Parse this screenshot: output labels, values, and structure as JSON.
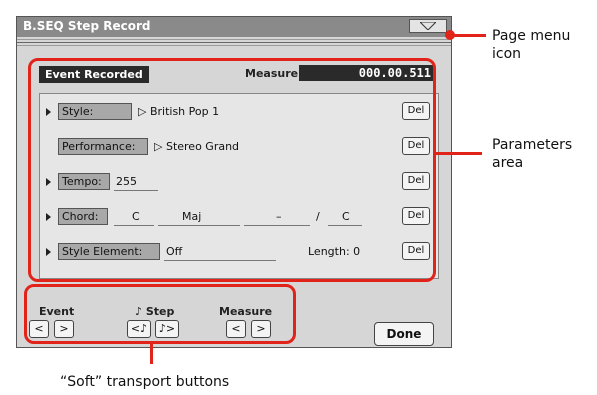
{
  "screen": {
    "title": "B.SEQ Step Record",
    "event_label": "Event Recorded",
    "measure_label": "Measure:",
    "measure_value": "000.00.511"
  },
  "rows": {
    "style": {
      "button": "Style:",
      "value": "▷ British Pop 1",
      "del": "Del"
    },
    "performance": {
      "button": "Performance:",
      "value": "▷ Stereo Grand",
      "del": "Del"
    },
    "tempo": {
      "button": "Tempo:",
      "value": "255",
      "del": "Del"
    },
    "chord": {
      "button": "Chord:",
      "root": "C",
      "type": "Maj",
      "dash": "–",
      "slash": "/",
      "bass": "C",
      "del": "Del"
    },
    "style_element": {
      "button": "Style Element:",
      "value": "Off",
      "length_label": "Length: 0",
      "del": "Del"
    }
  },
  "transport": {
    "event_label": "Event",
    "step_label": "♪ Step",
    "measure_label": "Measure",
    "prev": "<",
    "next": ">",
    "step_prev": "<♪",
    "step_next": "♪>"
  },
  "done_label": "Done",
  "callouts": {
    "page_menu": "Page menu icon",
    "parameters": "Parameters area",
    "transport": "“Soft” transport buttons"
  },
  "colors": {
    "accent": "#e2231a"
  }
}
